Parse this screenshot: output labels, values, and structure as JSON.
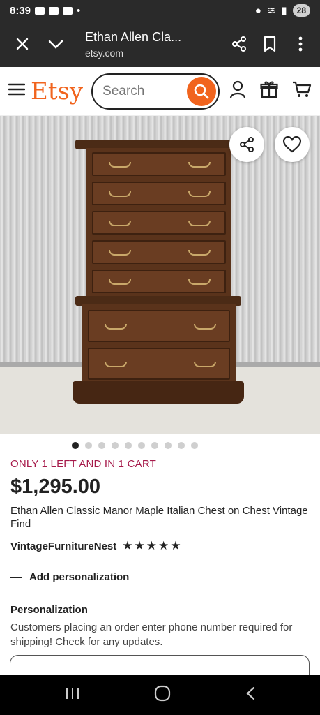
{
  "status_bar": {
    "time": "8:39",
    "battery": "28"
  },
  "browser": {
    "page_title": "Ethan Allen Cla...",
    "url": "etsy.com",
    "close_icon": "close-icon",
    "expand_icon": "chevron-down-icon",
    "share_icon": "share-icon",
    "bookmark_icon": "bookmark-icon",
    "menu_icon": "more-vert-icon"
  },
  "header": {
    "logo": "Etsy",
    "search_placeholder": "Search",
    "accent": "#f1641e"
  },
  "gallery": {
    "image_count": 10,
    "active_index": 0
  },
  "product": {
    "stock_notice": "ONLY 1 LEFT AND IN 1 CART",
    "price": "$1,295.00",
    "title": "Ethan Allen Classic Manor Maple Italian Chest on Chest Vintage Find",
    "seller": "VintageFurnitureNest",
    "rating_stars": 5,
    "add_personalization": "Add personalization",
    "personalization_heading": "Personalization",
    "personalization_desc": "Customers placing an order enter phone number required for shipping! Check for any updates."
  }
}
